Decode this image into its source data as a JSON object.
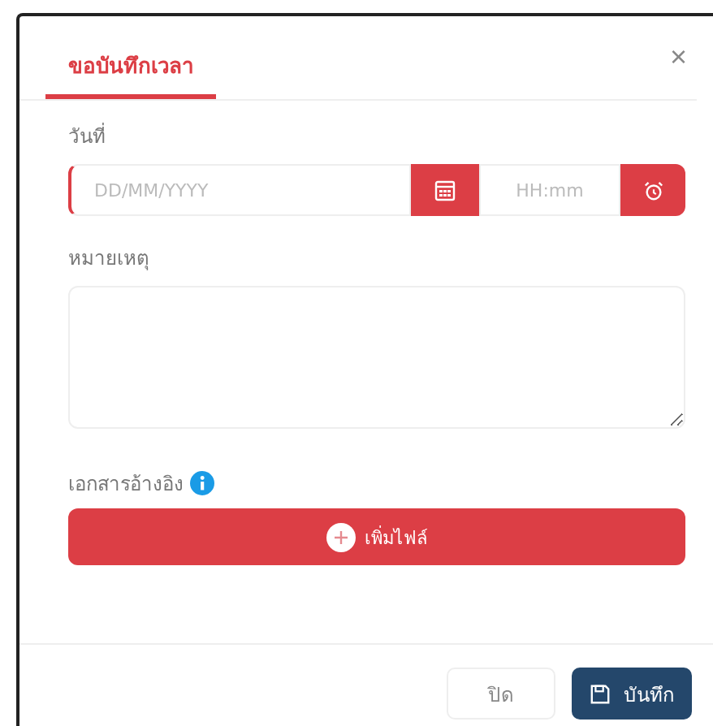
{
  "dialog": {
    "tabs": [
      {
        "label": "ขอบันทึกเวลา",
        "selected": true
      }
    ],
    "close_icon": "×"
  },
  "date_field": {
    "label": "วันที่",
    "date_placeholder": "DD/MM/YYYY",
    "time_placeholder": "HH:mm",
    "invalid": true
  },
  "remark_field": {
    "label": "หมายเหตุ"
  },
  "attachments": {
    "label": "เอกสารอ้างอิง",
    "add_button": "เพิ่มไฟล์"
  },
  "footer": {
    "buttons": [
      {
        "label": "ปิด",
        "kind": "secondary"
      },
      {
        "label": "บันทึก",
        "kind": "primary"
      }
    ]
  }
}
